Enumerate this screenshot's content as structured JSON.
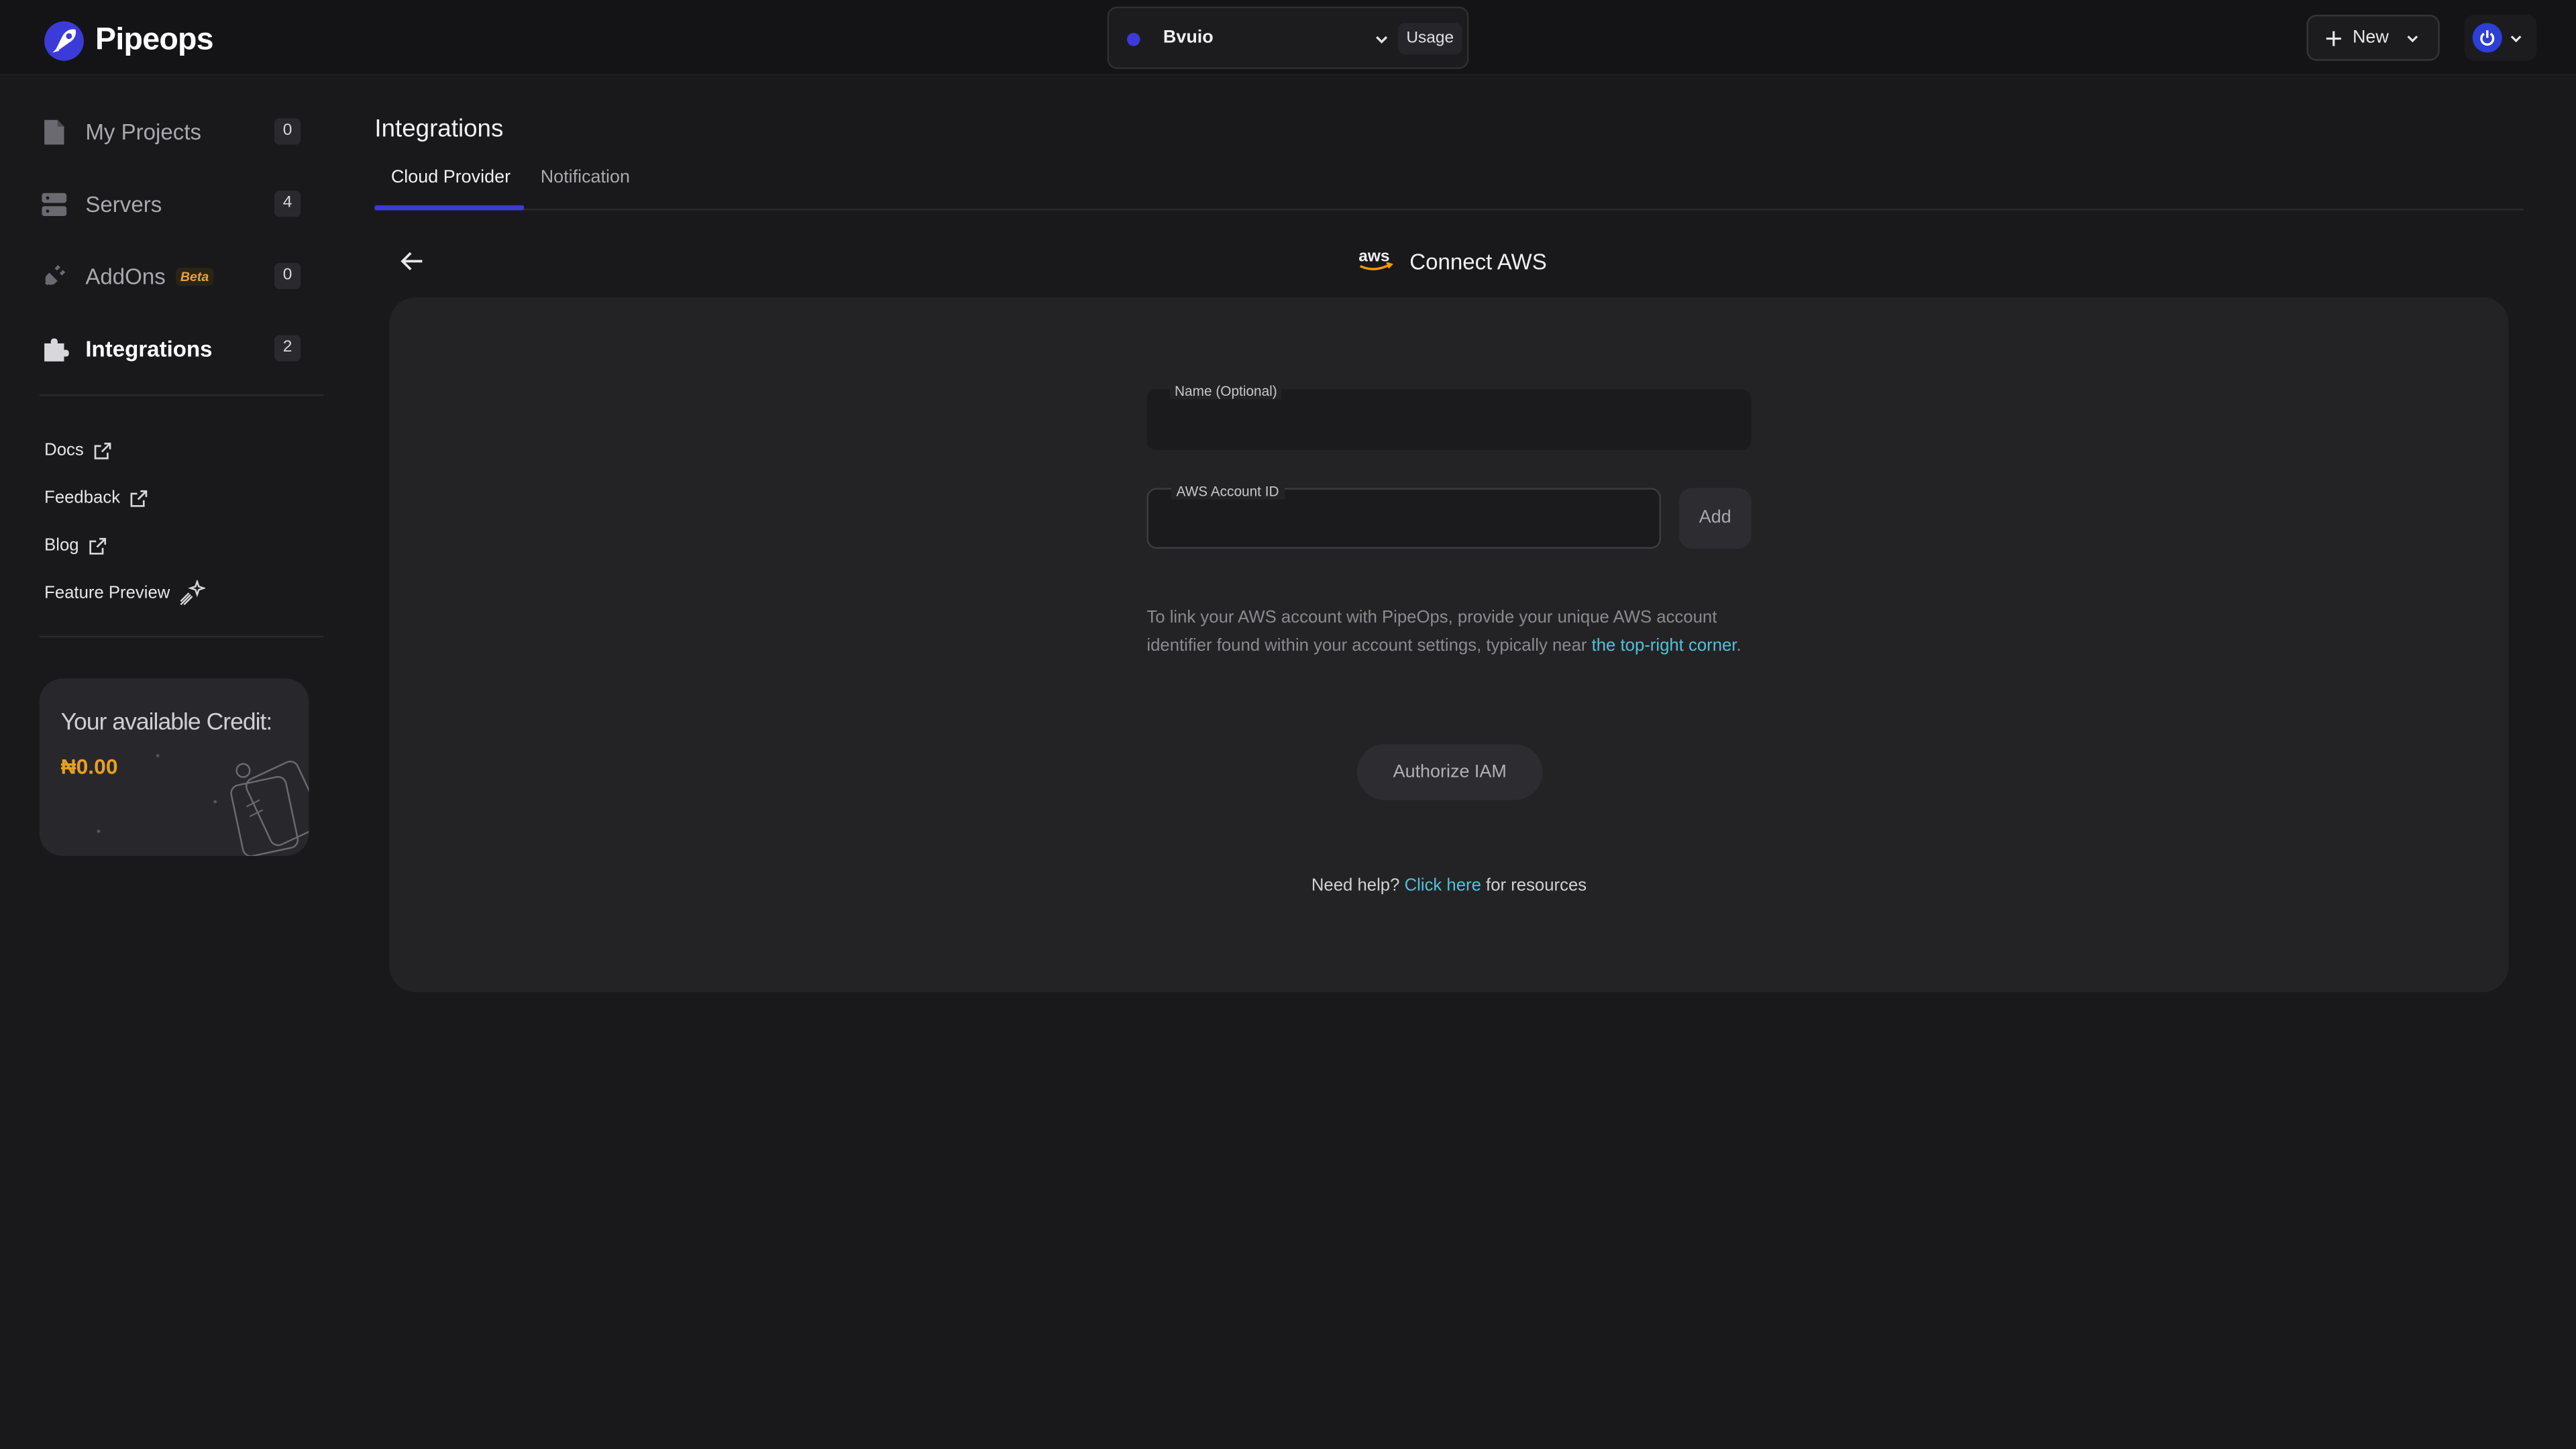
{
  "brand": {
    "name": "Pipeops",
    "accent": "#3b3bd9"
  },
  "topbar": {
    "project_name": "Bvuio",
    "usage_label": "Usage",
    "new_label": "New"
  },
  "sidebar": {
    "items": [
      {
        "label": "My Projects",
        "count": "0",
        "icon": "file-icon"
      },
      {
        "label": "Servers",
        "count": "4",
        "icon": "server-icon"
      },
      {
        "label": "AddOns",
        "badge": "Beta",
        "count": "0",
        "icon": "plug-icon"
      },
      {
        "label": "Integrations",
        "count": "2",
        "icon": "puzzle-icon",
        "active": true
      }
    ],
    "links": [
      {
        "label": "Docs",
        "icon": "external-link-icon"
      },
      {
        "label": "Feedback",
        "icon": "external-link-icon"
      },
      {
        "label": "Blog",
        "icon": "external-link-icon"
      },
      {
        "label": "Feature Preview",
        "icon": "sparkle-icon"
      }
    ],
    "credit": {
      "title": "Your available Credit:",
      "value": "₦0.00",
      "value_color": "#e8a020"
    }
  },
  "main": {
    "title": "Integrations",
    "tabs": [
      {
        "label": "Cloud Provider",
        "active": true
      },
      {
        "label": "Notification",
        "active": false
      }
    ],
    "connect_title": "Connect AWS",
    "form": {
      "name_label": "Name (Optional)",
      "name_value": "",
      "account_label": "AWS Account ID",
      "account_value": "",
      "add_label": "Add",
      "helper_text": "To link your AWS account with PipeOps, provide your unique AWS account identifier found within your account settings, typically near ",
      "helper_link": "the top-right corner",
      "helper_end": ".",
      "authorize_label": "Authorize IAM"
    },
    "help": {
      "prefix": "Need help? ",
      "link": "Click here",
      "suffix": " for resources",
      "link_color": "#4fc3d8"
    }
  }
}
